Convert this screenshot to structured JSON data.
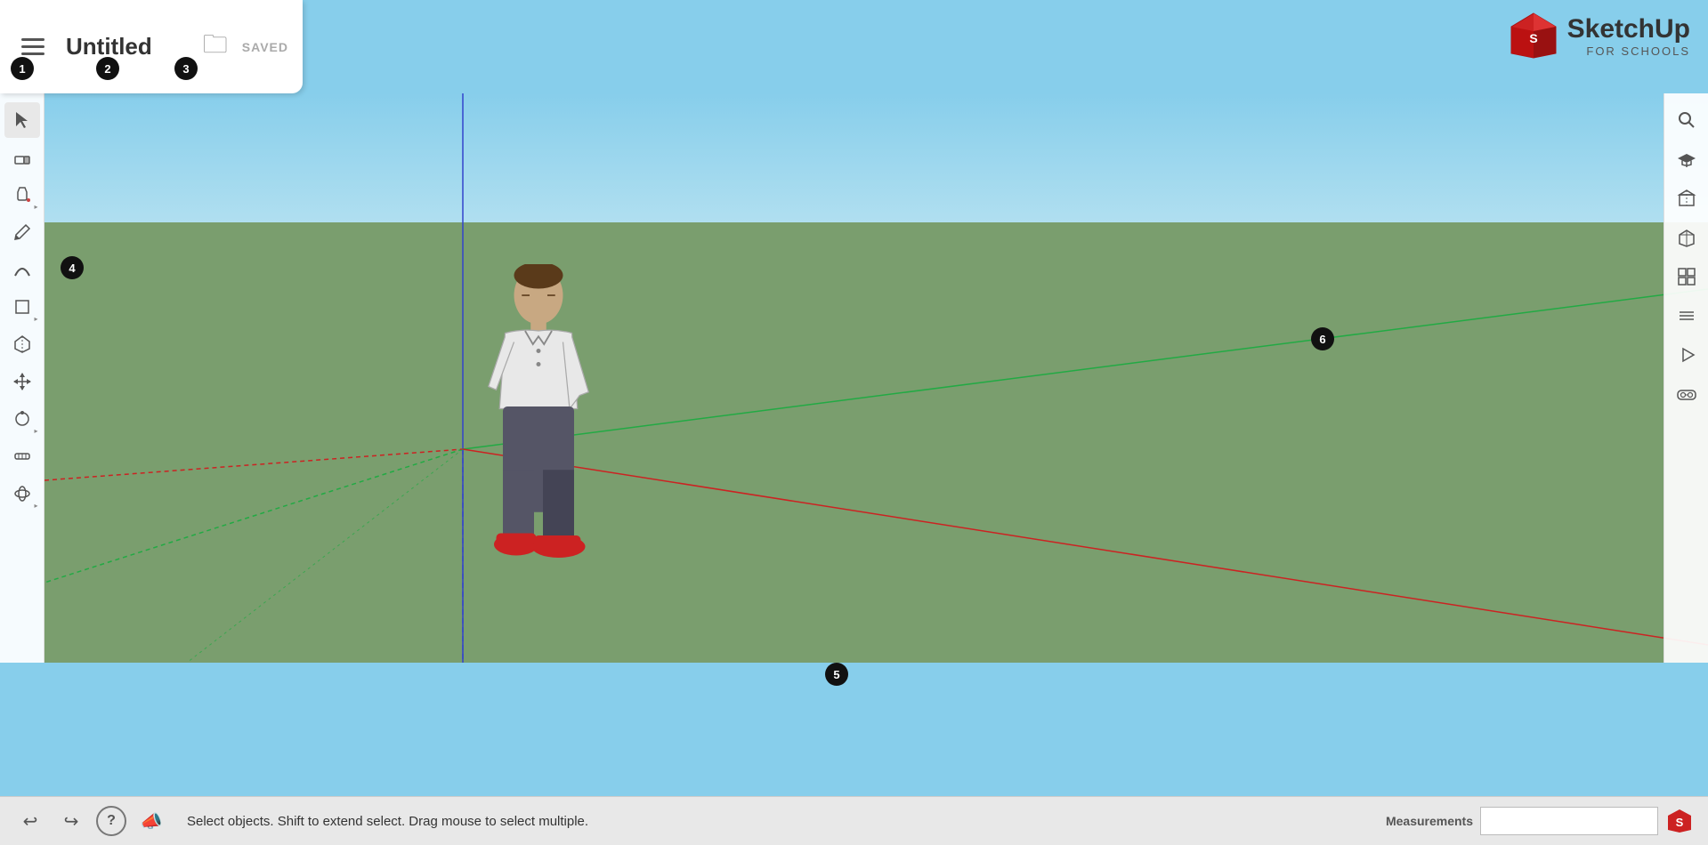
{
  "header": {
    "title": "Untitled",
    "save_status": "SAVED",
    "menu_icon": "☰"
  },
  "logo": {
    "name": "SketchUp",
    "sub": "FOR SCHOOLS"
  },
  "toolbar_left": {
    "tools": [
      {
        "id": "select",
        "icon": "↖",
        "label": "Select",
        "arrow": false,
        "active": true
      },
      {
        "id": "eraser",
        "icon": "◻",
        "label": "Eraser",
        "arrow": false
      },
      {
        "id": "paint",
        "icon": "⊛",
        "label": "Paint Bucket",
        "arrow": true
      },
      {
        "id": "pencil",
        "icon": "✏",
        "label": "Pencil",
        "arrow": false
      },
      {
        "id": "arc",
        "icon": "⌒",
        "label": "Arc",
        "arrow": false
      },
      {
        "id": "shapes",
        "icon": "⬡",
        "label": "Shapes",
        "arrow": true
      },
      {
        "id": "pushpull",
        "icon": "⊕",
        "label": "Push/Pull",
        "arrow": false
      },
      {
        "id": "move",
        "icon": "✛",
        "label": "Move",
        "arrow": false
      },
      {
        "id": "follow",
        "icon": "◎",
        "label": "Follow Me",
        "arrow": true
      },
      {
        "id": "tape",
        "icon": "⚲",
        "label": "Tape Measure",
        "arrow": false
      },
      {
        "id": "orbit",
        "icon": "⊕",
        "label": "Orbit",
        "arrow": true
      }
    ]
  },
  "toolbar_right": {
    "tools": [
      {
        "id": "search",
        "icon": "🔍",
        "label": "Search"
      },
      {
        "id": "graduate",
        "icon": "🎓",
        "label": "Graduate"
      },
      {
        "id": "3dwarehouse",
        "icon": "📦",
        "label": "3D Warehouse"
      },
      {
        "id": "isometric",
        "icon": "⬡",
        "label": "Isometric View"
      },
      {
        "id": "standard-views",
        "icon": "⬛",
        "label": "Standard Views"
      },
      {
        "id": "layers",
        "icon": "▤",
        "label": "Layers"
      },
      {
        "id": "scenes",
        "icon": "▶",
        "label": "Scenes"
      },
      {
        "id": "vr",
        "icon": "👓",
        "label": "VR Goggles"
      }
    ]
  },
  "badges": {
    "b1": "1",
    "b2": "2",
    "b3": "3",
    "b4": "4",
    "b5": "5",
    "b6": "6"
  },
  "bottom_bar": {
    "undo_icon": "↩",
    "redo_icon": "↪",
    "help_icon": "?",
    "announce_icon": "📣",
    "status_text": "Select objects. Shift to extend select. Drag mouse to select multiple.",
    "measurements_label": "Measurements"
  },
  "viewport": {
    "sky_color": "#87CEEB",
    "ground_color": "#7a9e6e"
  }
}
